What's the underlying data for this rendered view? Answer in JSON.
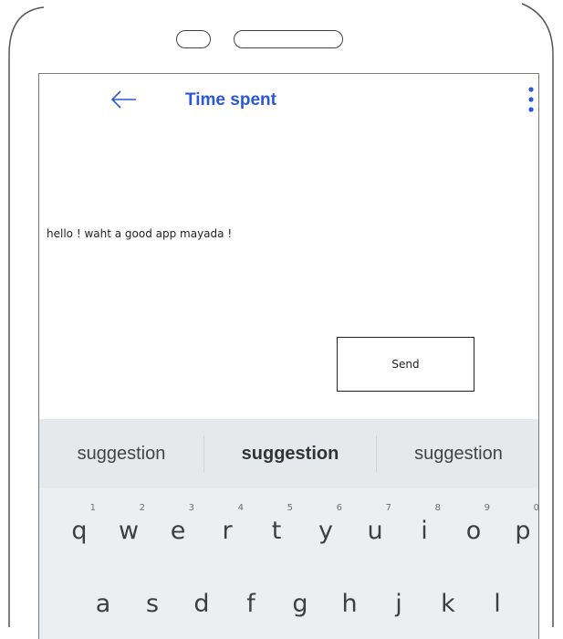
{
  "app_bar": {
    "back_icon": "arrow-left-icon",
    "title": "Time spent",
    "more_icon": "more-vert-icon",
    "accent_color": "#2b57d8"
  },
  "conversation": {
    "message": "hello ! waht a good app mayada !"
  },
  "composer": {
    "send_label": "Send"
  },
  "keyboard": {
    "suggestions": [
      "suggestion",
      "suggestion",
      "suggestion"
    ],
    "row1": [
      {
        "letter": "q",
        "hint": "1"
      },
      {
        "letter": "w",
        "hint": "2"
      },
      {
        "letter": "e",
        "hint": "3"
      },
      {
        "letter": "r",
        "hint": "4"
      },
      {
        "letter": "t",
        "hint": "5"
      },
      {
        "letter": "y",
        "hint": "6"
      },
      {
        "letter": "u",
        "hint": "7"
      },
      {
        "letter": "i",
        "hint": "8"
      },
      {
        "letter": "o",
        "hint": "9"
      },
      {
        "letter": "p",
        "hint": "0"
      }
    ],
    "row2": [
      {
        "letter": "a"
      },
      {
        "letter": "s"
      },
      {
        "letter": "d"
      },
      {
        "letter": "f"
      },
      {
        "letter": "g"
      },
      {
        "letter": "h"
      },
      {
        "letter": "j"
      },
      {
        "letter": "k"
      },
      {
        "letter": "l"
      }
    ]
  }
}
